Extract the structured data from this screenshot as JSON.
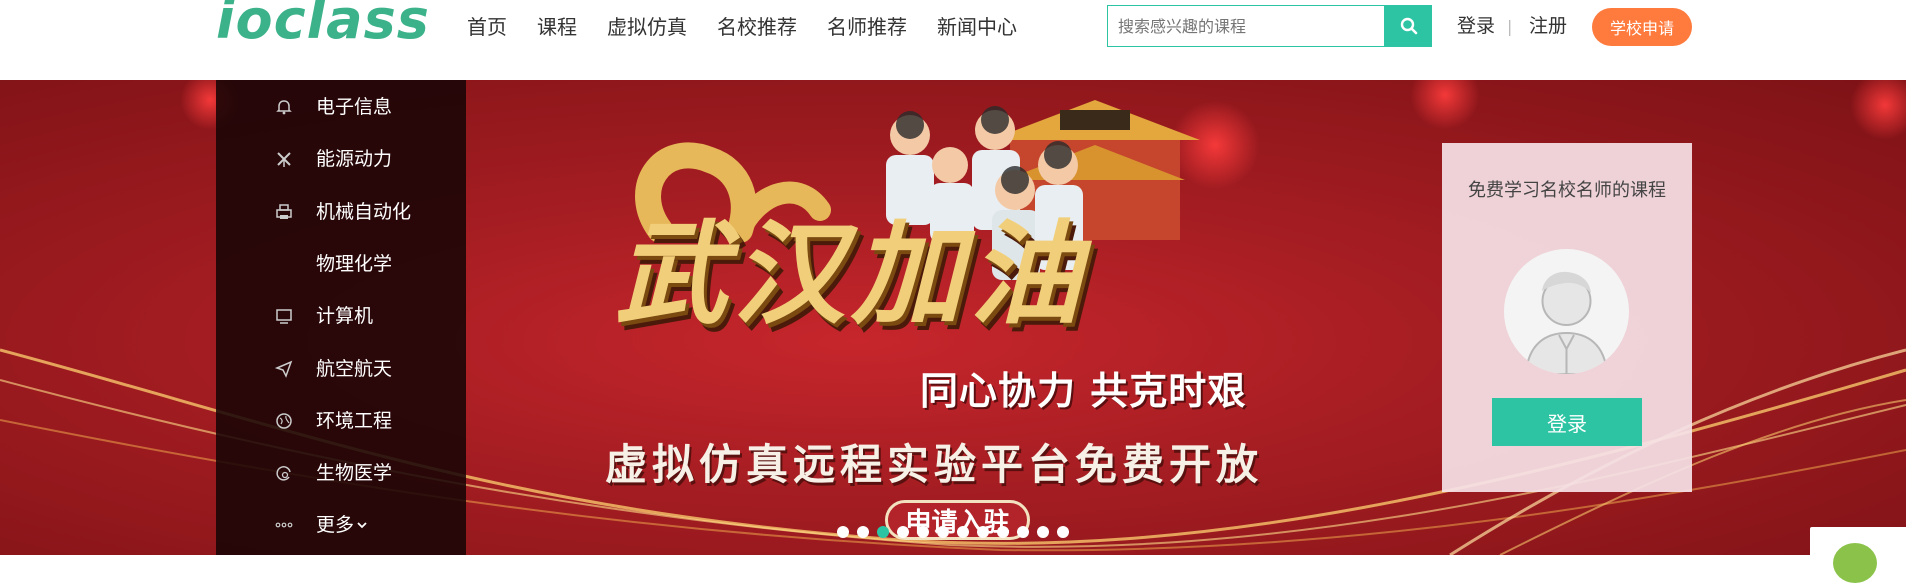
{
  "header": {
    "logo_text": "ioclass",
    "nav": [
      {
        "label": "首页"
      },
      {
        "label": "课程"
      },
      {
        "label": "虚拟仿真"
      },
      {
        "label": "名校推荐"
      },
      {
        "label": "名师推荐"
      },
      {
        "label": "新闻中心"
      }
    ],
    "search": {
      "placeholder": "搜索感兴趣的课程",
      "icon": "search-icon"
    },
    "login_label": "登录",
    "divider": "|",
    "register_label": "注册",
    "apply_label": "学校申请"
  },
  "categories": [
    {
      "label": "电子信息",
      "icon": "bell-icon"
    },
    {
      "label": "能源动力",
      "icon": "windmill-icon"
    },
    {
      "label": "机械自动化",
      "icon": "printer-icon"
    },
    {
      "label": "物理化学",
      "icon": ""
    },
    {
      "label": "计算机",
      "icon": "monitor-icon"
    },
    {
      "label": "航空航天",
      "icon": "paper-plane-icon"
    },
    {
      "label": "环境工程",
      "icon": "globe-icon"
    },
    {
      "label": "生物医学",
      "icon": "bio-icon"
    },
    {
      "label": "更多",
      "icon": "more-dots-icon"
    }
  ],
  "banner": {
    "slogan_main": "武汉加油",
    "slogan_sub": "同心协力 共克时艰",
    "headline": "虚拟仿真远程实验平台免费开放",
    "join_button": "申请入驻",
    "slide_count": 12,
    "active_slide": 3,
    "background_color": "#a51d22",
    "accent_gold": "#f1cf7a"
  },
  "login_card": {
    "text": "免费学习名校名师的课程",
    "login_button": "登录"
  },
  "colors": {
    "brand": "#2dc4a4",
    "orange": "#ff7a3d"
  }
}
